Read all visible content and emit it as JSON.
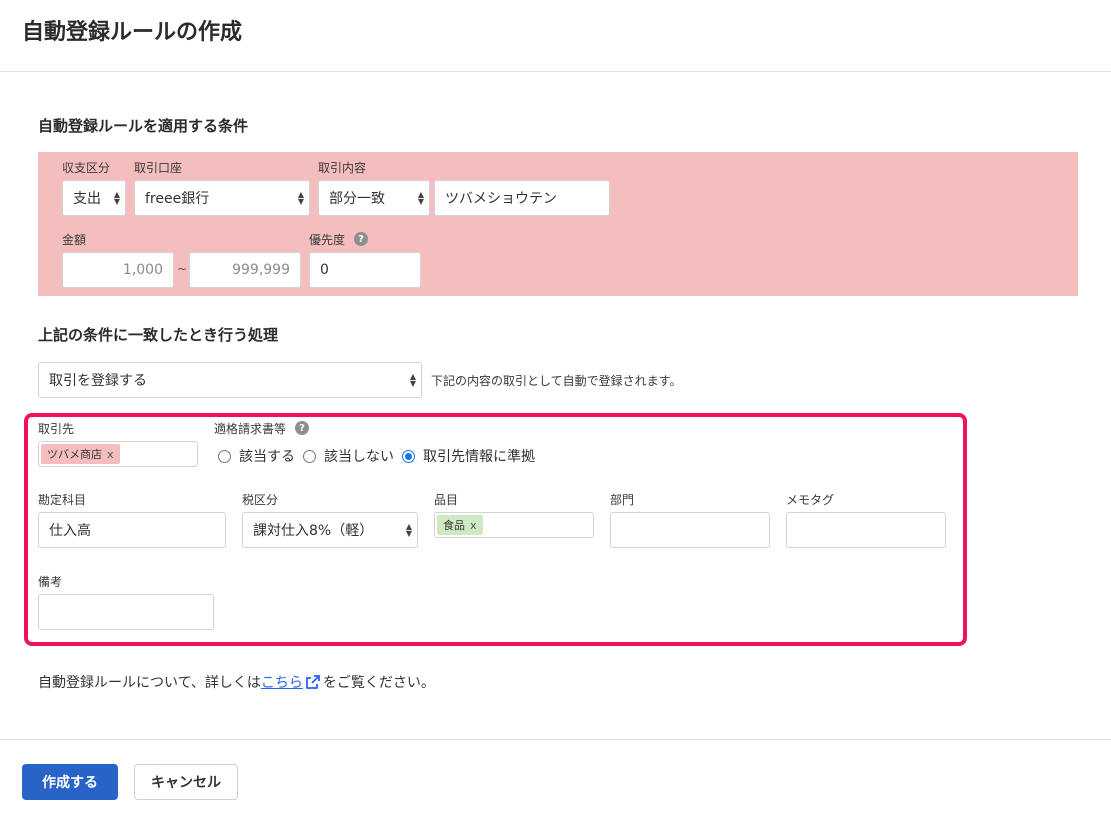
{
  "page": {
    "title": "自動登録ルールの作成"
  },
  "conditions": {
    "heading": "自動登録ルールを適用する条件",
    "income_expense": {
      "label": "収支区分",
      "value": "支出"
    },
    "account": {
      "label": "取引口座",
      "value": "freee銀行"
    },
    "content": {
      "label": "取引内容",
      "match_value": "部分一致",
      "text_value": "ツバメショウテン"
    },
    "amount": {
      "label": "金額",
      "min": "1,000",
      "separator": "~",
      "max": "999,999"
    },
    "priority": {
      "label": "優先度",
      "value": "0",
      "help": "?"
    }
  },
  "action": {
    "heading": "上記の条件に一致したとき行う処理",
    "select_value": "取引を登録する",
    "note": "下記の内容の取引として自動で登録されます。"
  },
  "details": {
    "partner": {
      "label": "取引先",
      "tag": "ツバメ商店",
      "remove": "x"
    },
    "invoice": {
      "label": "適格請求書等",
      "help": "?",
      "options": [
        "該当する",
        "該当しない",
        "取引先情報に準拠"
      ],
      "selected_index": 2
    },
    "account_item": {
      "label": "勘定科目",
      "value": "仕入高"
    },
    "tax": {
      "label": "税区分",
      "value": "課対仕入8%（軽）"
    },
    "item": {
      "label": "品目",
      "tag": "食品",
      "remove": "x"
    },
    "department": {
      "label": "部門",
      "value": ""
    },
    "memo_tag": {
      "label": "メモタグ",
      "value": ""
    },
    "remarks": {
      "label": "備考",
      "value": ""
    }
  },
  "info": {
    "prefix": "自動登録ルールについて、詳しくは",
    "link": "こちら",
    "suffix": "をご覧ください。"
  },
  "buttons": {
    "create": "作成する",
    "cancel": "キャンセル"
  },
  "colors": {
    "condition_bg": "#f5bebe",
    "highlight_border": "#f0125c",
    "primary": "#2864c8",
    "link": "#2864f0"
  }
}
